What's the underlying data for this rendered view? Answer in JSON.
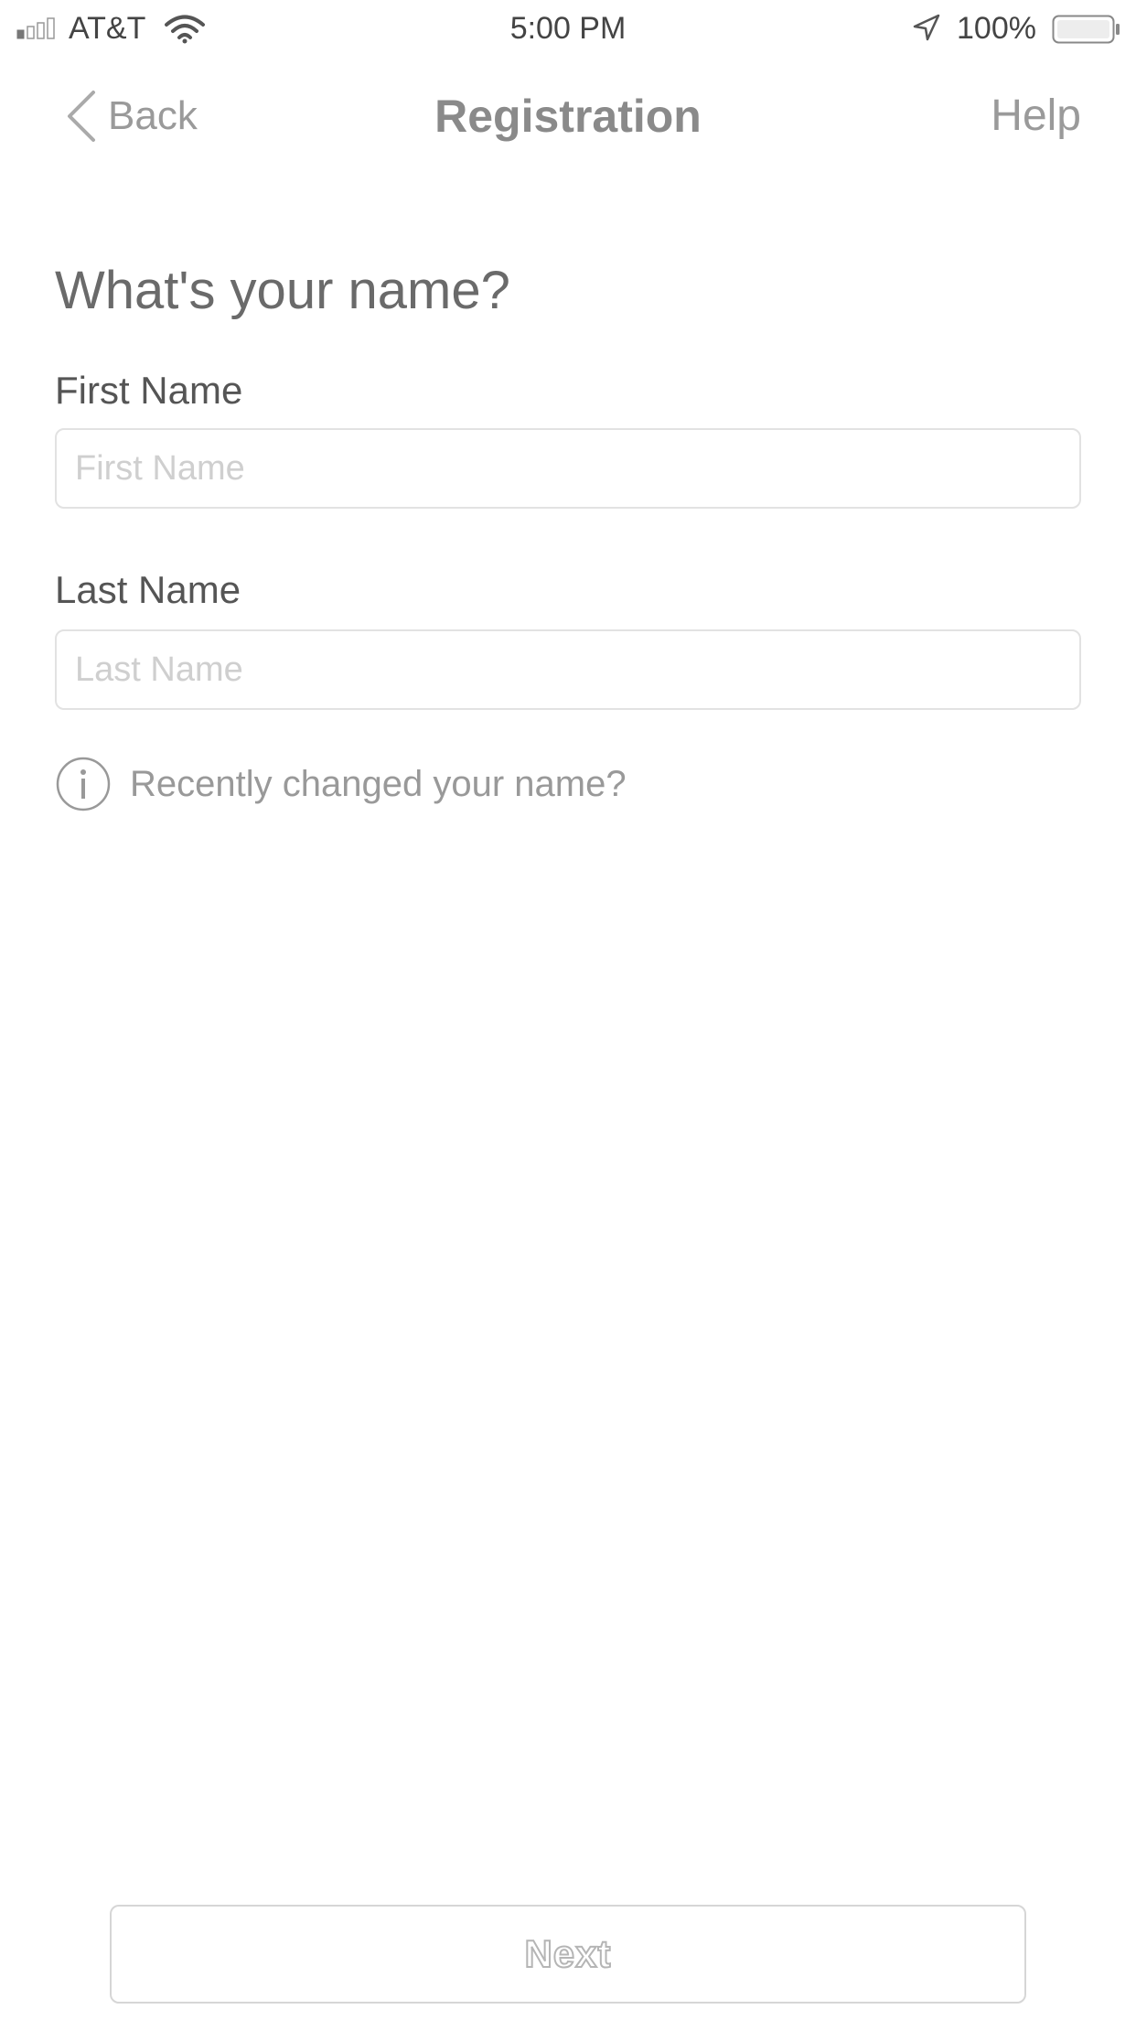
{
  "status_bar": {
    "carrier": "AT&T",
    "time": "5:00 PM",
    "battery_percent": "100%",
    "signal_icon": "cellular-signal-icon",
    "wifi_icon": "wifi-icon",
    "location_icon": "location-arrow-icon",
    "battery_icon": "battery-icon"
  },
  "nav": {
    "back_label": "Back",
    "back_icon": "chevron-left-icon",
    "title": "Registration",
    "help_label": "Help"
  },
  "form": {
    "heading": "What's your name?",
    "first_name_label": "First Name",
    "first_name_placeholder": "First Name",
    "first_name_value": "",
    "last_name_label": "Last Name",
    "last_name_placeholder": "Last Name",
    "last_name_value": "",
    "info_icon": "info-icon",
    "info_text": "Recently changed your name?"
  },
  "footer": {
    "next_label": "Next"
  },
  "colors": {
    "background": "#ffffff",
    "nav_text": "#9a9a9a",
    "input_border": "#e2e2e2",
    "placeholder": "#cfcfcf",
    "button_border": "#d6d6d6"
  }
}
